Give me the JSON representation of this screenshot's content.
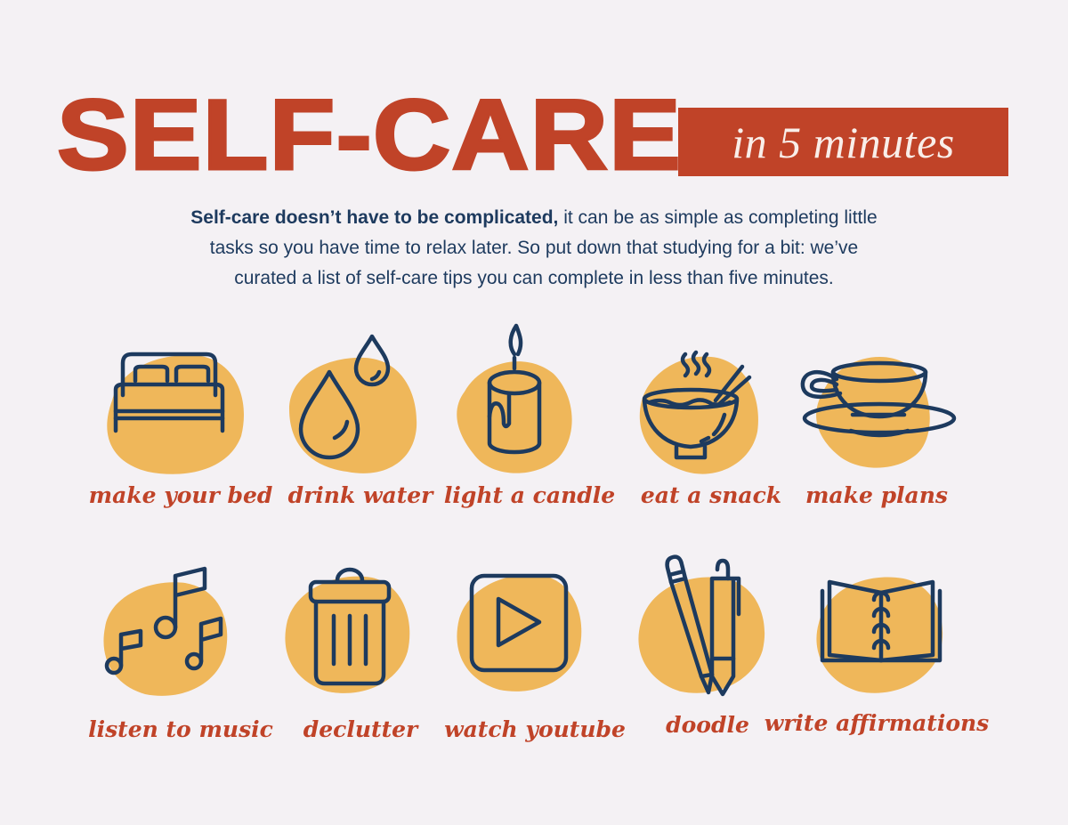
{
  "header": {
    "title": "SELF-CARE",
    "badge": "in 5 minutes"
  },
  "intro": {
    "bold": "Self-care doesn’t have to be complicated,",
    "line1_rest": " it can be as simple as completing little",
    "line2": "tasks so you have time to relax later. So put down that studying for a bit: we’ve",
    "line3": "curated a list of self-care tips you can complete in less than five minutes."
  },
  "colors": {
    "accent": "#c04328",
    "blob": "#efb75a",
    "ink": "#1d3a5e",
    "background": "#f4f1f4"
  },
  "tips": [
    {
      "label": "make your bed",
      "icon": "bed-icon"
    },
    {
      "label": "drink water",
      "icon": "water-drops-icon"
    },
    {
      "label": "light a candle",
      "icon": "candle-icon"
    },
    {
      "label": "eat a snack",
      "icon": "bowl-icon"
    },
    {
      "label": "make plans",
      "icon": "teacup-icon"
    },
    {
      "label": "listen to music",
      "icon": "music-notes-icon"
    },
    {
      "label": "declutter",
      "icon": "trash-can-icon"
    },
    {
      "label": "watch youtube",
      "icon": "play-button-icon"
    },
    {
      "label": "doodle",
      "icon": "pencil-pen-icon"
    },
    {
      "label": "write affirmations",
      "icon": "notebook-icon"
    }
  ]
}
